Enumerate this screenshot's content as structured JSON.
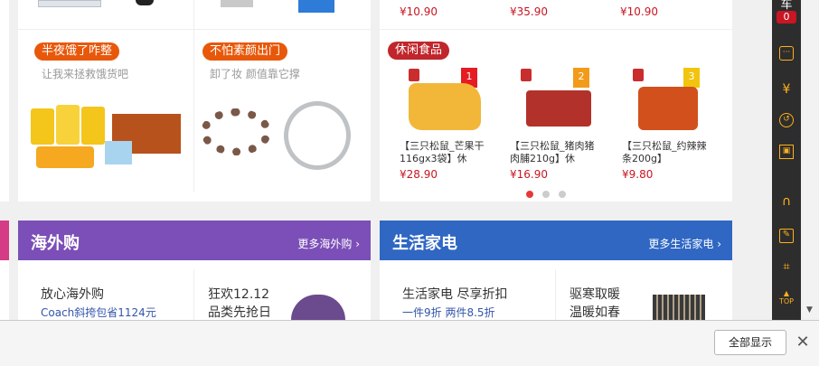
{
  "top_prices": [
    "¥10.90",
    "¥35.90",
    "¥10.90"
  ],
  "promo_left": [
    {
      "tag": "半夜饿了咋整",
      "sub": "让我来拯救饿货吧"
    },
    {
      "tag": "不怕素颜出门",
      "sub": "卸了妆 颜值靠它撑"
    }
  ],
  "snacks": {
    "tag": "休闲食品",
    "products": [
      {
        "rank": "1",
        "title": "【三只松鼠_芒果干116gx3袋】休",
        "price": "¥28.90"
      },
      {
        "rank": "2",
        "title": "【三只松鼠_猪肉猪肉脯210g】休",
        "price": "¥16.90"
      },
      {
        "rank": "3",
        "title": "【三只松鼠_约辣辣条200g】",
        "price": "¥9.80"
      }
    ]
  },
  "sections": [
    {
      "title": "海外购",
      "more": "更多海外购",
      "color": "#7b4fb7",
      "tiles": [
        {
          "title": "放心海外购",
          "sub": "Coach斜挎包省1124元"
        },
        {
          "title": "狂欢12.12",
          "title2": "品类先抢日"
        }
      ]
    },
    {
      "title": "生活家电",
      "more": "更多生活家电",
      "color": "#2f67c3",
      "tiles": [
        {
          "title": "生活家电 尽享折扣",
          "sub": "一件9折 两件8.5折"
        },
        {
          "title": "驱寒取暖",
          "title2": "温暖如春"
        }
      ]
    }
  ],
  "sidebar": {
    "cart_char": "车",
    "badge": "0",
    "top_label": "TOP"
  },
  "bottom_bar": {
    "show_all": "全部显示",
    "close": "✕"
  }
}
